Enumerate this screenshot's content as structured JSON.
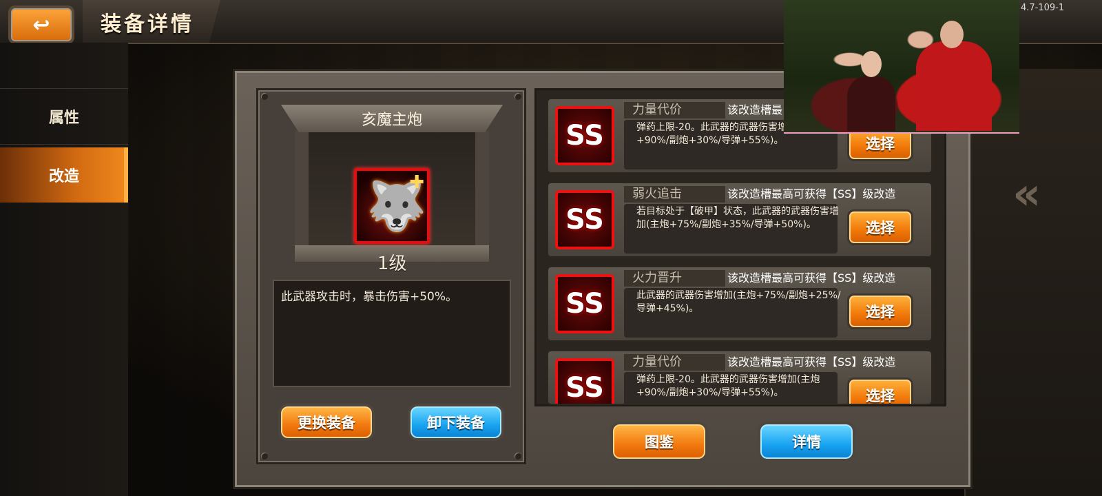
{
  "header": {
    "back_icon": "↩",
    "title": "装备详情",
    "corner_code": "4.7-109-1"
  },
  "sidebar": {
    "items": [
      {
        "label": "属性",
        "active": false
      },
      {
        "label": "改造",
        "active": true
      }
    ]
  },
  "equipment": {
    "name": "亥魔主炮",
    "level": "1级",
    "icon": "beast-cannon-icon",
    "description": "此武器攻击时，暴击伤害+50%。",
    "replace_label": "更换装备",
    "unequip_label": "卸下装备"
  },
  "modifications": [
    {
      "grade": "SS",
      "name": "力量代价",
      "tier_note": "该改造槽最",
      "description": "弹药上限-20。此武器的武器伤害增加(主炮+90%/副炮+30%/导弹+55%)。",
      "select_label": "选择"
    },
    {
      "grade": "SS",
      "name": "弱火追击",
      "tier_note": "该改造槽最高可获得【SS】级改造",
      "description": "若目标处于【破甲】状态，此武器的武器伤害增加(主炮+75%/副炮+35%/导弹+50%)。",
      "select_label": "选择"
    },
    {
      "grade": "SS",
      "name": "火力晋升",
      "tier_note": "该改造槽最高可获得【SS】级改造",
      "description": "此武器的武器伤害增加(主炮+75%/副炮+25%/导弹+45%)。",
      "select_label": "选择"
    },
    {
      "grade": "SS",
      "name": "力量代价",
      "tier_note": "该改造槽最高可获得【SS】级改造",
      "description": "弹药上限-20。此武器的武器伤害增加(主炮+90%/副炮+30%/导弹+55%)。",
      "select_label": "选择"
    }
  ],
  "footer": {
    "codex_label": "图鉴",
    "details_label": "详情"
  },
  "colors": {
    "accent_orange": "#f2780e",
    "accent_blue": "#17a3f0",
    "ss_red": "#e11111"
  }
}
